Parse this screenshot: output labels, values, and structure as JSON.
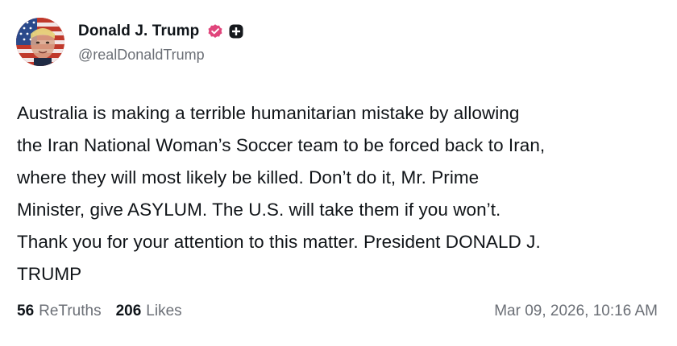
{
  "author": {
    "display_name": "Donald J. Trump",
    "handle": "@realDonaldTrump",
    "avatar_icon": "profile-avatar",
    "verified_icon": "verified-badge-icon",
    "verified_color": "#e0457b",
    "plus_icon": "plus-badge-icon"
  },
  "post": {
    "text": "Australia is making a terrible humanitarian mistake by allowing\nthe Iran National Woman’s Soccer team to be forced back to Iran,\nwhere they will most likely be killed. Don’t do it, Mr. Prime\nMinister, give ASYLUM. The U.S. will take them if you won’t.\nThank you for your attention to this matter. President DONALD J.\nTRUMP"
  },
  "stats": {
    "retruths_count": "56",
    "retruths_label": "ReTruths",
    "likes_count": "206",
    "likes_label": "Likes"
  },
  "timestamp": "Mar 09, 2026, 10:16 AM"
}
